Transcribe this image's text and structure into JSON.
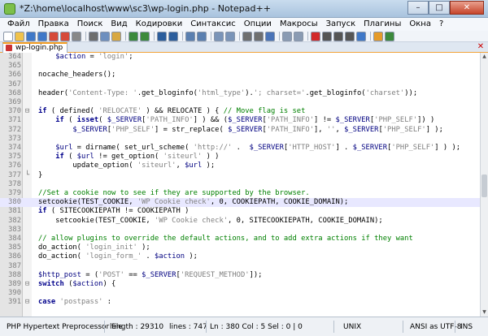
{
  "window": {
    "title": "*Z:\\home\\localhost\\www\\sc3\\wp-login.php - Notepad++",
    "minimize": "–",
    "maximize": "□",
    "close": "✕"
  },
  "menu": [
    "Файл",
    "Правка",
    "Поиск",
    "Вид",
    "Кодировки",
    "Синтаксис",
    "Опции",
    "Макросы",
    "Запуск",
    "Плагины",
    "Окна",
    "?"
  ],
  "tabs": [
    {
      "label": "wp-login.php"
    }
  ],
  "tab_close": "✕",
  "editor": {
    "current_line": 380,
    "lines": [
      {
        "n": 364,
        "fold": "",
        "html": "    <span class=\"var\">$action</span> = <span class=\"str\">'login'</span>;"
      },
      {
        "n": 365,
        "fold": "",
        "html": ""
      },
      {
        "n": 366,
        "fold": "",
        "html": "nocache_headers();"
      },
      {
        "n": 367,
        "fold": "",
        "html": ""
      },
      {
        "n": 368,
        "fold": "",
        "html": "header(<span class=\"str\">'Content-Type: '</span>.get_bloginfo(<span class=\"str\">'html_type'</span>).<span class=\"str\">'; charset='</span>.get_bloginfo(<span class=\"str\">'charset'</span>));"
      },
      {
        "n": 369,
        "fold": "",
        "html": ""
      },
      {
        "n": 370,
        "fold": "⊟",
        "html": "<span class=\"kw\">if</span> ( defined( <span class=\"str\">'RELOCATE'</span> ) &amp;&amp; RELOCATE ) { <span class=\"cm\">// Move flag is set</span>"
      },
      {
        "n": 371,
        "fold": "",
        "html": "    <span class=\"kw\">if</span> ( <span class=\"kw\">isset</span>( <span class=\"var\">$_SERVER</span>[<span class=\"str\">'PATH_INFO'</span>] ) &amp;&amp; (<span class=\"var\">$_SERVER</span>[<span class=\"str\">'PATH_INFO'</span>] != <span class=\"var\">$_SERVER</span>[<span class=\"str\">'PHP_SELF'</span>]) )"
      },
      {
        "n": 372,
        "fold": "",
        "html": "        <span class=\"var\">$_SERVER</span>[<span class=\"str\">'PHP_SELF'</span>] = str_replace( <span class=\"var\">$_SERVER</span>[<span class=\"str\">'PATH_INFO'</span>], <span class=\"str\">''</span>, <span class=\"var\">$_SERVER</span>[<span class=\"str\">'PHP_SELF'</span>] );"
      },
      {
        "n": 373,
        "fold": "",
        "html": ""
      },
      {
        "n": 374,
        "fold": "",
        "html": "    <span class=\"var\">$url</span> = dirname( set_url_scheme( <span class=\"str\">'http://'</span> .  <span class=\"var\">$_SERVER</span>[<span class=\"str\">'HTTP_HOST'</span>] . <span class=\"var\">$_SERVER</span>[<span class=\"str\">'PHP_SELF'</span>] ) );"
      },
      {
        "n": 375,
        "fold": "",
        "html": "    <span class=\"kw\">if</span> ( <span class=\"var\">$url</span> != get_option( <span class=\"str\">'siteurl'</span> ) )"
      },
      {
        "n": 376,
        "fold": "",
        "html": "        update_option( <span class=\"str\">'siteurl'</span>, <span class=\"var\">$url</span> );"
      },
      {
        "n": 377,
        "fold": "└",
        "html": "}"
      },
      {
        "n": 378,
        "fold": "",
        "html": ""
      },
      {
        "n": 379,
        "fold": "",
        "html": "<span class=\"cm\">//Set a cookie now to see if they are supported by the browser.</span>"
      },
      {
        "n": 380,
        "fold": "",
        "html": "setcookie(TEST_COOKIE, <span class=\"str\">'WP Cookie check'</span>, 0, COOKIEPATH, COOKIE_DOMAIN);"
      },
      {
        "n": 381,
        "fold": "",
        "html": "<span class=\"kw\">if</span> ( SITECOOKIEPATH != COOKIEPATH )"
      },
      {
        "n": 382,
        "fold": "",
        "html": "    setcookie(TEST_COOKIE, <span class=\"str\">'WP Cookie check'</span>, 0, SITECOOKIEPATH, COOKIE_DOMAIN);"
      },
      {
        "n": 383,
        "fold": "",
        "html": ""
      },
      {
        "n": 384,
        "fold": "",
        "html": "<span class=\"cm\">// allow plugins to override the default actions, and to add extra actions if they want</span>"
      },
      {
        "n": 385,
        "fold": "",
        "html": "do_action( <span class=\"str\">'login_init'</span> );"
      },
      {
        "n": 386,
        "fold": "",
        "html": "do_action( <span class=\"str\">'login_form_'</span> . <span class=\"var\">$action</span> );"
      },
      {
        "n": 387,
        "fold": "",
        "html": ""
      },
      {
        "n": 388,
        "fold": "",
        "html": "<span class=\"var\">$http_post</span> = (<span class=\"str\">'POST'</span> == <span class=\"var\">$_SERVER</span>[<span class=\"str\">'REQUEST_METHOD'</span>]);"
      },
      {
        "n": 389,
        "fold": "⊟",
        "html": "<span class=\"kw\">switch</span> (<span class=\"var\">$action</span>) {"
      },
      {
        "n": 390,
        "fold": "",
        "html": ""
      },
      {
        "n": 391,
        "fold": "⊟",
        "html": "<span class=\"kw\">case</span> <span class=\"str\">'postpass'</span> :"
      }
    ]
  },
  "status": {
    "file_type": "PHP Hypertext Preprocessor file",
    "length": "length : 29310",
    "lines": "lines : 747",
    "position": "Ln : 380   Col : 5   Sel : 0 | 0",
    "eol": "UNIX",
    "encoding": "ANSI as UTF-8",
    "mode": "INS"
  },
  "toolbar_buttons": [
    {
      "icon": "new-file-icon",
      "color": "#ffffff"
    },
    {
      "icon": "open-file-icon",
      "color": "#f0c24b"
    },
    {
      "icon": "save-icon",
      "color": "#3f78c8"
    },
    {
      "icon": "save-all-icon",
      "color": "#3f78c8"
    },
    {
      "icon": "close-icon",
      "color": "#d64a3a"
    },
    {
      "icon": "close-all-icon",
      "color": "#d64a3a"
    },
    {
      "icon": "print-icon",
      "color": "#888888"
    },
    {
      "sep": true
    },
    {
      "icon": "cut-icon",
      "color": "#6d6d6d"
    },
    {
      "icon": "copy-icon",
      "color": "#6d8fbf"
    },
    {
      "icon": "paste-icon",
      "color": "#d8a842"
    },
    {
      "sep": true
    },
    {
      "icon": "undo-icon",
      "color": "#3c8a3c"
    },
    {
      "icon": "redo-icon",
      "color": "#3c8a3c"
    },
    {
      "sep": true
    },
    {
      "icon": "find-icon",
      "color": "#2b5d9c"
    },
    {
      "icon": "replace-icon",
      "color": "#2b5d9c"
    },
    {
      "sep": true
    },
    {
      "icon": "zoom-in-icon",
      "color": "#5a7fb0"
    },
    {
      "icon": "zoom-out-icon",
      "color": "#5a7fb0"
    },
    {
      "sep": true
    },
    {
      "icon": "sync-vertical-icon",
      "color": "#7a94b8"
    },
    {
      "icon": "sync-horizontal-icon",
      "color": "#7a94b8"
    },
    {
      "sep": true
    },
    {
      "icon": "word-wrap-icon",
      "color": "#6f6f6f"
    },
    {
      "icon": "show-all-chars-icon",
      "color": "#6f6f6f"
    },
    {
      "icon": "indent-guide-icon",
      "color": "#4a74b8"
    },
    {
      "sep": true
    },
    {
      "icon": "doc-map-icon",
      "color": "#8a9bb3"
    },
    {
      "icon": "function-list-icon",
      "color": "#8a9bb3"
    },
    {
      "sep": true
    },
    {
      "icon": "record-macro-icon",
      "color": "#d22a2a"
    },
    {
      "icon": "stop-record-icon",
      "color": "#555555"
    },
    {
      "icon": "play-macro-icon",
      "color": "#555555"
    },
    {
      "icon": "play-multiple-icon",
      "color": "#555555"
    },
    {
      "icon": "save-macro-icon",
      "color": "#3f78c8"
    },
    {
      "sep": true
    },
    {
      "icon": "run-icon",
      "color": "#e59b2a"
    },
    {
      "icon": "spell-check-icon",
      "color": "#3c8a3c"
    }
  ]
}
